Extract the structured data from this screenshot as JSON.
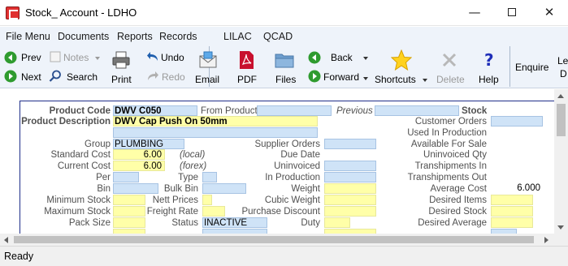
{
  "window": {
    "title": "Stock_ Account - LDHO"
  },
  "menu": {
    "items": [
      "File Menu",
      "Documents",
      "Reports",
      "Records",
      "LILAC",
      "QCAD"
    ]
  },
  "toolbar": {
    "prev": "Prev",
    "next": "Next",
    "notes": "Notes",
    "search": "Search",
    "print": "Print",
    "undo": "Undo",
    "redo": "Redo",
    "email": "Email",
    "pdf": "PDF",
    "files": "Files",
    "back": "Back",
    "forward": "Forward",
    "shortcuts": "Shortcuts",
    "delete": "Delete",
    "help": "Help",
    "enquire": "Enquire",
    "overflow_top": "Le",
    "overflow_bottom": "D"
  },
  "form": {
    "product_code_label": "Product Code",
    "product_code": "DWV C050",
    "from_product_label": "From Product",
    "previous_label": "Previous",
    "stock_label": "Stock",
    "product_description_label": "Product Description",
    "product_description": "DWV Cap Push On 50mm",
    "group_label": "Group",
    "group": "PLUMBING",
    "standard_cost_label": "Standard Cost",
    "standard_cost": "6.00",
    "standard_cost_note": "(local)",
    "current_cost_label": "Current Cost",
    "current_cost": "6.00",
    "current_cost_note": "(forex)",
    "per_label": "Per",
    "bin_label": "Bin",
    "minimum_stock_label": "Minimum Stock",
    "maximum_stock_label": "Maximum Stock",
    "pack_size_label": "Pack Size",
    "supplier_orders_label": "Supplier Orders",
    "due_date_label": "Due Date",
    "type_label": "Type",
    "bulk_bin_label": "Bulk Bin",
    "nett_prices_label": "Nett Prices",
    "freight_rate_label": "Freight Rate",
    "status_label": "Status",
    "status": "INACTIVE",
    "uninvoiced_label": "Uninvoiced",
    "in_production_label": "In Production",
    "weight_label": "Weight",
    "cubic_weight_label": "Cubic Weight",
    "purchase_discount_label": "Purchase Discount",
    "duty_label": "Duty",
    "customer_orders_label": "Customer Orders",
    "used_in_production_label": "Used In Production",
    "available_for_sale_label": "Available For Sale",
    "uninvoiced_qty_label": "Uninvoiced Qty",
    "transhipments_in_label": "Transhipments In",
    "transhipments_out_label": "Transhipments Out",
    "average_cost_label": "Average Cost",
    "average_cost": "6.000",
    "desired_items_label": "Desired Items",
    "desired_stock_label": "Desired Stock",
    "desired_average_label": "Desired Average"
  },
  "status": {
    "text": "Ready"
  },
  "colors": {
    "field_blue": "#cfe3f7",
    "field_yellow": "#ffffa8",
    "form_border": "#1f2e8a",
    "toolbar_bg": "#eef3fa"
  }
}
